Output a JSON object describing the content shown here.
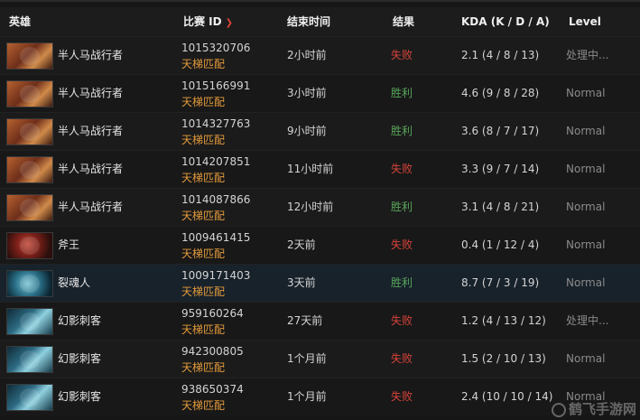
{
  "header": {
    "hero": "英雄",
    "match_id": "比赛 ID",
    "end_time": "结束时间",
    "result": "结果",
    "kda": "KDA (K / D / A)",
    "level": "Level"
  },
  "rows": [
    {
      "hero": "半人马战行者",
      "portrait": "centaur",
      "match_id": "1015320706",
      "mode": "天梯匹配",
      "end_time": "2小时前",
      "result": "失败",
      "kda": "2.1 (4 / 8 / 13)",
      "level": "处理中..."
    },
    {
      "hero": "半人马战行者",
      "portrait": "centaur",
      "match_id": "1015166991",
      "mode": "天梯匹配",
      "end_time": "3小时前",
      "result": "胜利",
      "kda": "4.6 (9 / 8 / 28)",
      "level": "Normal"
    },
    {
      "hero": "半人马战行者",
      "portrait": "centaur",
      "match_id": "1014327763",
      "mode": "天梯匹配",
      "end_time": "9小时前",
      "result": "胜利",
      "kda": "3.6 (8 / 7 / 17)",
      "level": "Normal"
    },
    {
      "hero": "半人马战行者",
      "portrait": "centaur",
      "match_id": "1014207851",
      "mode": "天梯匹配",
      "end_time": "11小时前",
      "result": "失败",
      "kda": "3.3 (9 / 7 / 14)",
      "level": "Normal"
    },
    {
      "hero": "半人马战行者",
      "portrait": "centaur",
      "match_id": "1014087866",
      "mode": "天梯匹配",
      "end_time": "12小时前",
      "result": "胜利",
      "kda": "3.1 (4 / 8 / 21)",
      "level": "Normal"
    },
    {
      "hero": "斧王",
      "portrait": "axe",
      "match_id": "1009461415",
      "mode": "天梯匹配",
      "end_time": "2天前",
      "result": "失败",
      "kda": "0.4 (1 / 12 / 4)",
      "level": "Normal"
    },
    {
      "hero": "裂魂人",
      "portrait": "spectre",
      "match_id": "1009171403",
      "mode": "天梯匹配",
      "end_time": "3天前",
      "result": "胜利",
      "kda": "8.7 (7 / 3 / 19)",
      "level": "Normal"
    },
    {
      "hero": "幻影刺客",
      "portrait": "pa",
      "match_id": "959160264",
      "mode": "天梯匹配",
      "end_time": "27天前",
      "result": "失败",
      "kda": "1.2 (4 / 13 / 12)",
      "level": "处理中..."
    },
    {
      "hero": "幻影刺客",
      "portrait": "pa",
      "match_id": "942300805",
      "mode": "天梯匹配",
      "end_time": "1个月前",
      "result": "失败",
      "kda": "1.5 (2 / 10 / 13)",
      "level": "Normal"
    },
    {
      "hero": "幻影刺客",
      "portrait": "pa",
      "match_id": "938650374",
      "mode": "天梯匹配",
      "end_time": "1个月前",
      "result": "失败",
      "kda": "2.4 (10 / 10 / 14)",
      "level": "Normal"
    }
  ],
  "watermark": "鹤飞手游网",
  "colors": {
    "win": "#58a65a",
    "loss": "#d6433a",
    "mode": "#e39a3b",
    "sort_arrow": "#e0443a"
  },
  "icons": {
    "sort": "chevron-down-icon",
    "watermark_logo": "watermark-logo-icon"
  }
}
